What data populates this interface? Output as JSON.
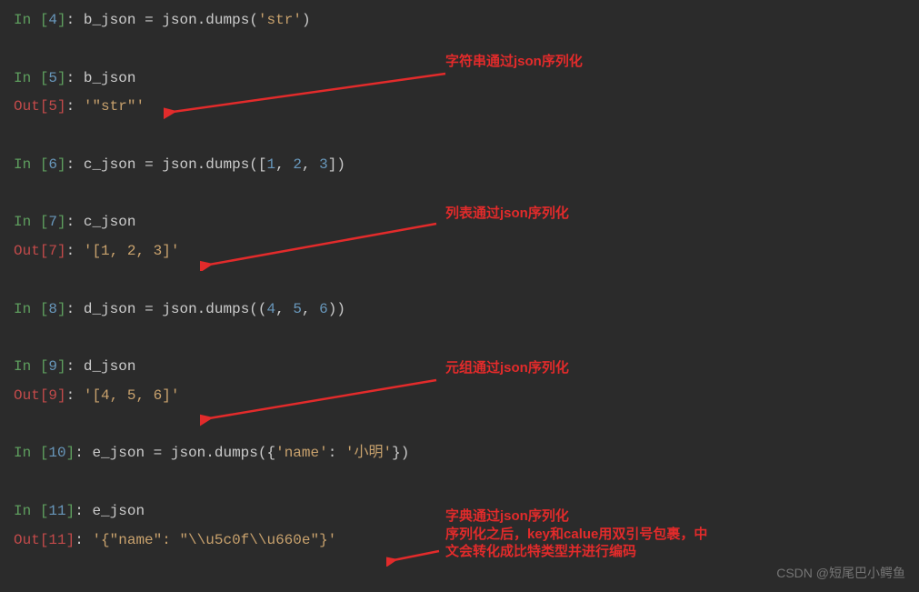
{
  "lines": {
    "l4": {
      "in": "In ",
      "idx": "4",
      "code_parts": [
        "b_json ",
        "=",
        " json",
        ".",
        "dumps",
        "(",
        "'str'",
        ")"
      ]
    },
    "l5_in": {
      "in": "In ",
      "idx": "5",
      "var": "b_json"
    },
    "l5_out": {
      "out": "Out",
      "idx": "5",
      "val": "'\"str\"'"
    },
    "l6": {
      "in": "In ",
      "idx": "6",
      "code_pre": "c_json = json.dumps([",
      "n1": "1",
      "n2": "2",
      "n3": "3",
      "code_post": "])"
    },
    "l7_in": {
      "in": "In ",
      "idx": "7",
      "var": "c_json"
    },
    "l7_out": {
      "out": "Out",
      "idx": "7",
      "val": "'[1, 2, 3]'"
    },
    "l8": {
      "in": "In ",
      "idx": "8",
      "code_pre": "d_json = json.dumps((",
      "n1": "4",
      "n2": "5",
      "n3": "6",
      "code_post": "))"
    },
    "l9_in": {
      "in": "In ",
      "idx": "9",
      "var": "d_json"
    },
    "l9_out": {
      "out": "Out",
      "idx": "9",
      "val": "'[4, 5, 6]'"
    },
    "l10": {
      "in": "In ",
      "idx": "10",
      "code_pre": "e_json = json.dumps({",
      "key": "'name'",
      "colon": ": ",
      "val": "'小明'",
      "code_post": "})"
    },
    "l11_in": {
      "in": "In ",
      "idx": "11",
      "var": "e_json"
    },
    "l11_out": {
      "out": "Out",
      "idx": "11",
      "val": "'{\"name\": \"\\\\u5c0f\\\\u660e\"}'"
    }
  },
  "annotations": {
    "a1": "字符串通过json序列化",
    "a2": "列表通过json序列化",
    "a3": "元组通过json序列化",
    "a4_l1": "字典通过json序列化",
    "a4_l2": "序列化之后，key和calue用双引号包裹，中",
    "a4_l3": "文会转化成比特类型并进行编码"
  },
  "watermark": "CSDN @短尾巴小鳄鱼"
}
